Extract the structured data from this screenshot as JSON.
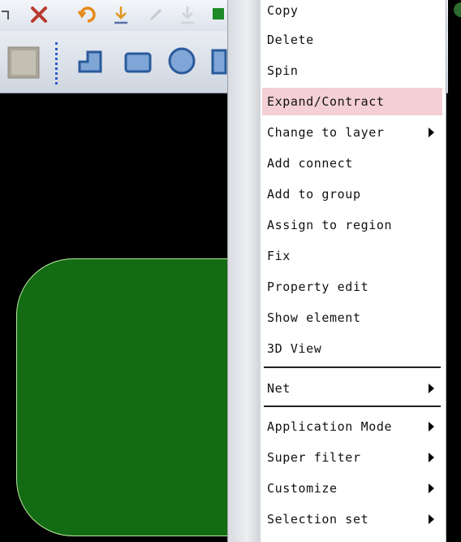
{
  "toolbar": {
    "icons_row1": [
      "undo-arrow-icon",
      "delete-x-icon",
      "redo-icon",
      "import-icon",
      "disabled-icon",
      "export-icon",
      "component-icon"
    ],
    "icons_row2": [
      "select-box-icon",
      "polyline-icon",
      "rectangle-icon",
      "circle-icon",
      "polygon-icon"
    ]
  },
  "colors": {
    "shape_fill": "#136b14",
    "shape_outline": "#b8e6a0",
    "menu_highlight": "#f4d0d4"
  },
  "context_menu": {
    "items": [
      {
        "label": "Copy",
        "submenu": false
      },
      {
        "label": "Delete",
        "submenu": false
      },
      {
        "label": "Spin",
        "submenu": false
      },
      {
        "label": "Expand/Contract",
        "submenu": false,
        "highlighted": true
      },
      {
        "label": "Change to layer",
        "submenu": true
      },
      {
        "label": "Add connect",
        "submenu": false
      },
      {
        "label": "Add to group",
        "submenu": false
      },
      {
        "label": "Assign to region",
        "submenu": false
      },
      {
        "label": "Fix",
        "submenu": false
      },
      {
        "label": "Property edit",
        "submenu": false
      },
      {
        "label": "Show element",
        "submenu": false
      },
      {
        "label": "3D View",
        "submenu": false
      },
      {
        "label": "Net",
        "submenu": true
      },
      {
        "label": "Application Mode",
        "submenu": true
      },
      {
        "label": "Super filter",
        "submenu": true
      },
      {
        "label": "Customize",
        "submenu": true
      },
      {
        "label": "Selection set",
        "submenu": true
      }
    ]
  }
}
